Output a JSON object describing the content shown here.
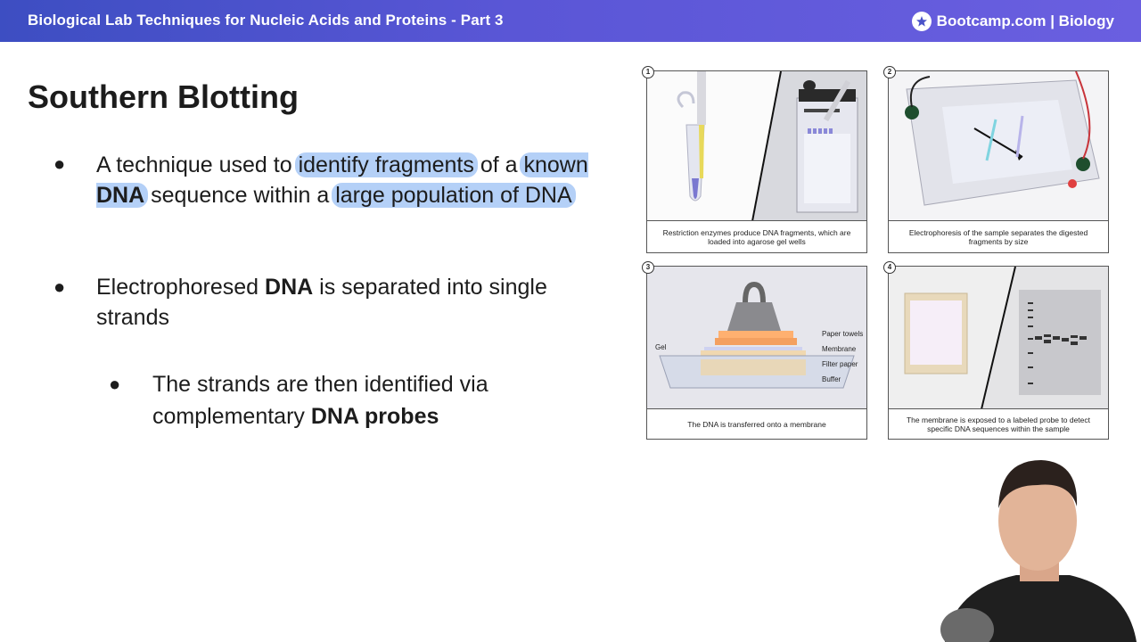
{
  "header": {
    "title": "Biological Lab Techniques for Nucleic Acids and Proteins - Part 3",
    "brand": "Bootcamp.com | Biology",
    "brand_icon": "bootcamp-star-logo",
    "gradient_start": "#3d4ec2",
    "gradient_end": "#6a5fe0"
  },
  "slide": {
    "heading": "Southern Blotting",
    "highlight_color": "#76aaf0",
    "bullet1": {
      "p1": "A technique used to ",
      "h1": "identify fragments",
      "p2": " of a ",
      "h2a": "known ",
      "h2b": "DNA",
      "p3": " sequence within a ",
      "h3": "large population of DNA"
    },
    "bullet2": {
      "p1": "Electrophoresed ",
      "b1": "DNA",
      "p2": " is separated into single strands"
    },
    "bullet3": {
      "p1": "The strands are then identified via complementary ",
      "b1": "DNA probes"
    }
  },
  "figure": {
    "panels": [
      {
        "num": "1",
        "caption": "Restriction enzymes produce DNA fragments, which are loaded into agarose gel wells"
      },
      {
        "num": "2",
        "caption": "Electrophoresis of the sample separates the digested fragments by size"
      },
      {
        "num": "3",
        "caption": "The DNA is transferred onto a membrane"
      },
      {
        "num": "4",
        "caption": "The membrane is exposed to a labeled probe to detect specific DNA sequences within the sample"
      }
    ],
    "panel3_labels": {
      "gel": "Gel",
      "paper_towels": "Paper towels",
      "membrane": "Membrane",
      "filter_paper": "Filter paper",
      "buffer": "Buffer"
    }
  }
}
